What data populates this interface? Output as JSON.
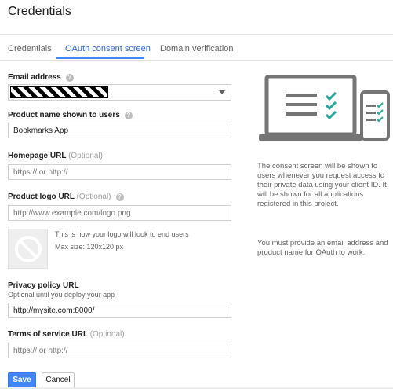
{
  "page": {
    "title": "Credentials"
  },
  "tabs": [
    {
      "label": "Credentials"
    },
    {
      "label": "OAuth consent screen"
    },
    {
      "label": "Domain verification"
    }
  ],
  "form": {
    "email": {
      "label": "Email address"
    },
    "product_name": {
      "label": "Product name shown to users",
      "value": "Bookmarks App"
    },
    "homepage": {
      "label": "Homepage URL",
      "optional": "(Optional)",
      "placeholder": "https:// or http://"
    },
    "logo": {
      "label": "Product logo URL",
      "optional": "(Optional)",
      "placeholder": "http://www.example.com/logo.png",
      "preview_note": "This is how your logo will look to end users",
      "max_size": "Max size: 120x120 px"
    },
    "privacy": {
      "label": "Privacy policy URL",
      "sublabel": "Optional until you deploy your app",
      "value": "http://mysite.com:8000/"
    },
    "terms": {
      "label": "Terms of service URL",
      "optional": "(Optional)",
      "placeholder": "https:// or http://"
    }
  },
  "buttons": {
    "save": "Save",
    "cancel": "Cancel"
  },
  "help_glyph": "?",
  "sidebar": {
    "paragraph1": "The consent screen will be shown to users whenever you request access to their private data using your client ID. It will be shown for all applications registered in this project.",
    "paragraph2": "You must provide an email address and product name for OAuth to work."
  },
  "colors": {
    "accent": "#4285f4",
    "check_green": "#26a69a",
    "illustration_gray": "#757575"
  }
}
